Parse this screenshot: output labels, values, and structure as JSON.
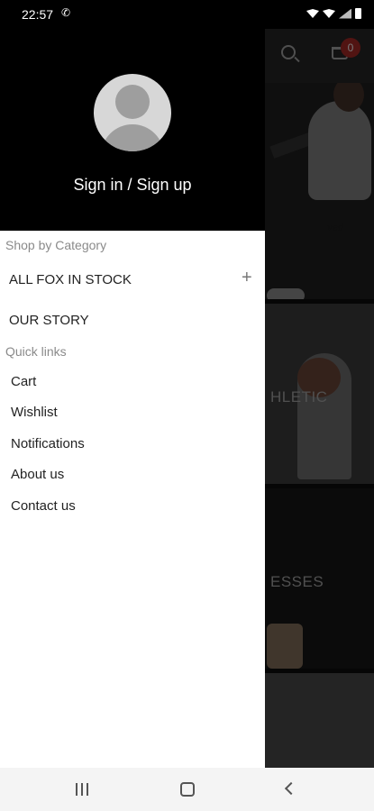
{
  "status_bar": {
    "time": "22:57",
    "call_icon": "phone-icon",
    "icons": [
      "wifi-calling-icon",
      "wifi-icon",
      "signal-icon",
      "battery-icon"
    ]
  },
  "background_app": {
    "cart_badge": "0",
    "hero_text": "ved",
    "tiles": [
      {
        "label": "HLETIC"
      },
      {
        "label": "ESSES"
      }
    ]
  },
  "drawer": {
    "sign_in_label": "Sign in / Sign up",
    "shop_by_category_label": "Shop by Category",
    "categories": [
      {
        "label": "ALL FOX IN STOCK",
        "expand_icon": "+"
      },
      {
        "label": "OUR STORY"
      }
    ],
    "quick_links_label": "Quick links",
    "quick_links": [
      {
        "label": "Cart"
      },
      {
        "label": "Wishlist"
      },
      {
        "label": "Notifications"
      },
      {
        "label": "About us"
      },
      {
        "label": "Contact us"
      }
    ]
  },
  "colors": {
    "drawer_header_bg": "#000000",
    "cart_badge_bg": "#8c2320",
    "nav_bar_bg": "#f4f4f4"
  }
}
